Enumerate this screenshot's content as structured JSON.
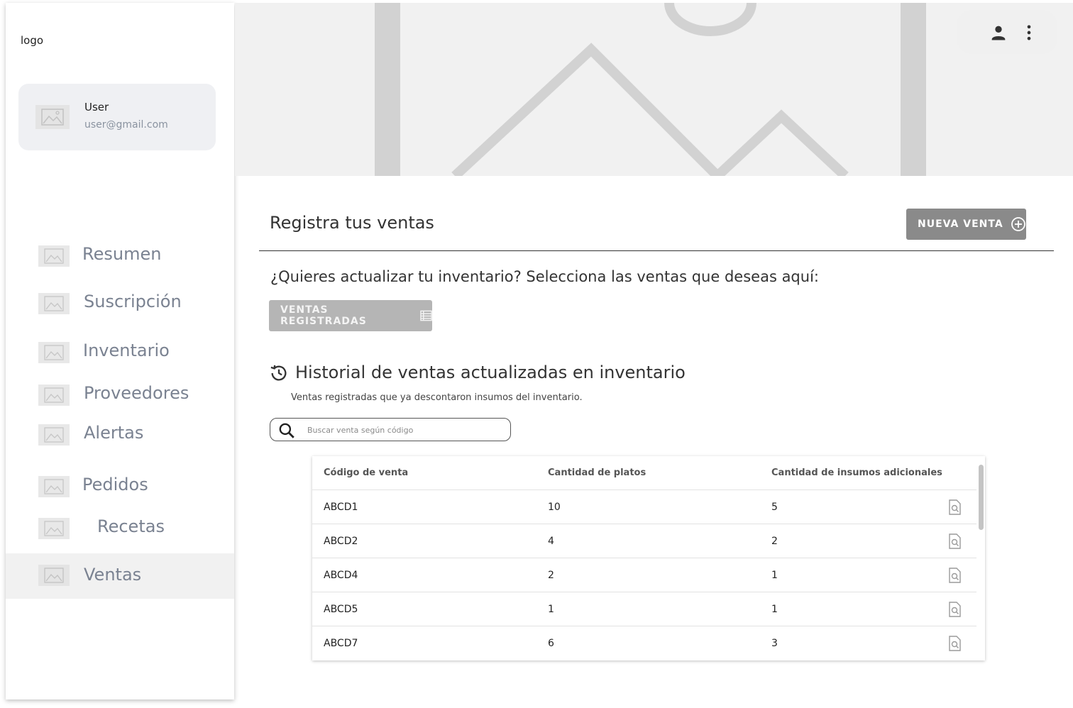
{
  "sidebar": {
    "logo": "logo",
    "user": {
      "name": "User",
      "email": "user@gmail.com"
    },
    "items": [
      {
        "label": "Resumen"
      },
      {
        "label": "Suscripción"
      },
      {
        "label": "Inventario"
      },
      {
        "label": "Proveedores"
      },
      {
        "label": "Alertas"
      },
      {
        "label": "Pedidos"
      },
      {
        "label": "Recetas"
      },
      {
        "label": "Ventas",
        "active": true
      }
    ]
  },
  "header": {
    "icons": [
      "user-icon",
      "more-vert-icon"
    ]
  },
  "main": {
    "title": "Registra tus ventas",
    "new_sale_button": "NUEVA VENTA",
    "question": "¿Quieres actualizar tu inventario? Selecciona las ventas que deseas aquí:",
    "registered_button": "VENTAS REGISTRADAS",
    "history": {
      "title": "Historial de ventas actualizadas en inventario",
      "subtitle": "Ventas registradas que ya descontaron insumos del inventario.",
      "search_placeholder": "Buscar venta según código"
    },
    "table": {
      "headers": [
        "Código de venta",
        "Cantidad de platos",
        "Cantidad de insumos adicionales"
      ],
      "rows": [
        {
          "code": "ABCD1",
          "plates": "10",
          "extras": "5"
        },
        {
          "code": "ABCD2",
          "plates": "4",
          "extras": "2"
        },
        {
          "code": "ABCD4",
          "plates": "2",
          "extras": "1"
        },
        {
          "code": "ABCD5",
          "plates": "1",
          "extras": "1"
        },
        {
          "code": "ABCD7",
          "plates": "6",
          "extras": "3"
        }
      ]
    }
  },
  "colors": {
    "primary_button": "#8a8a8a",
    "disabled_button": "#b5b5b5",
    "active_nav_bg": "#f1f1f1",
    "nav_text": "#7a8291"
  }
}
